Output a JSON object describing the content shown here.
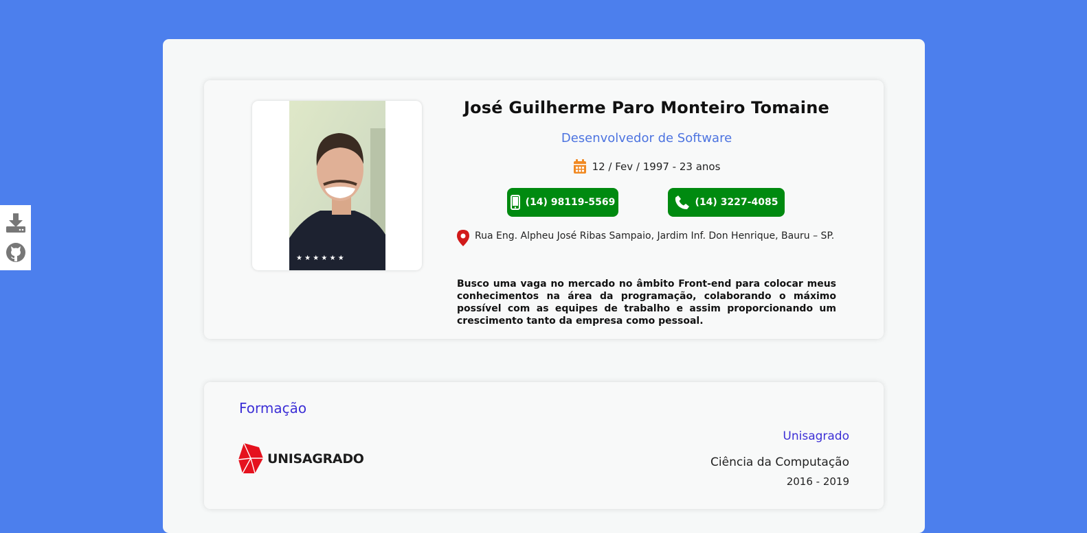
{
  "sidebar": {
    "download_icon": "download-icon",
    "github_icon": "github-icon"
  },
  "profile": {
    "name": "José Guilherme Paro Monteiro Tomaine",
    "role": "Desenvolvedor de Software",
    "birth": "12 / Fev / 1997 - 23 anos",
    "phone_mobile": "(14) 98119-5569",
    "phone_landline": "(14) 3227-4085",
    "address": "Rua Eng. Alpheu José Ribas Sampaio, Jardim Inf. Don Henrique, Bauru – SP.",
    "about": "Busco uma vaga no mercado no âmbito Front-end para colocar meus conhecimentos na área da programação, colaborando o máximo possível com as equipes de trabalho e assim proporcionando um crescimento tanto da empresa como pessoal."
  },
  "education": {
    "title": "Formação",
    "logo_text": "UNISAGRADO",
    "school": "Unisagrado",
    "course": "Ciência da Computação",
    "years": "2016 - 2019"
  },
  "colors": {
    "background": "#4c7fed",
    "accent": "#4c73e0",
    "phone_button": "#008a10",
    "section_title": "#3c2fd6",
    "calendar_icon": "#f08a24",
    "location_icon": "#d11a1a"
  }
}
